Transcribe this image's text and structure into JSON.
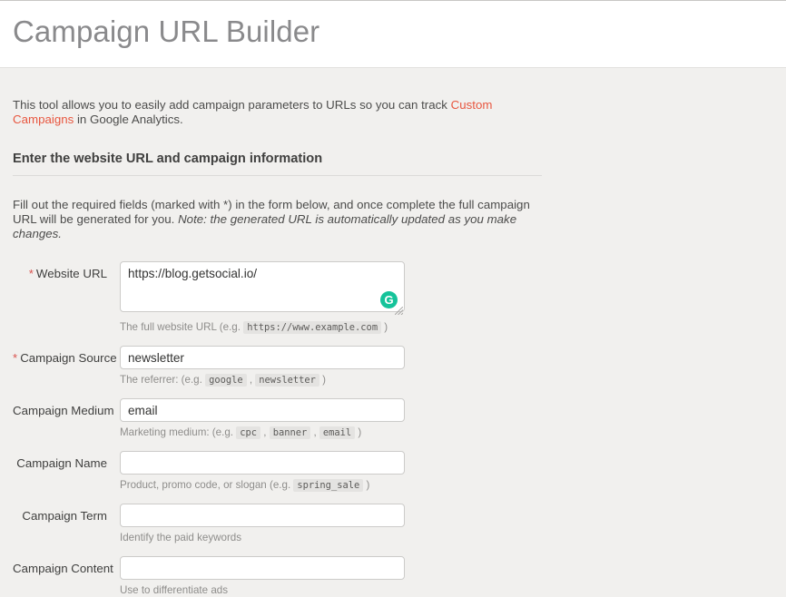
{
  "header": {
    "title": "Campaign URL Builder"
  },
  "intro": {
    "before_link": "This tool allows you to easily add campaign parameters to URLs so you can track ",
    "link_text": "Custom Campaigns",
    "after_link": " in Google Analytics."
  },
  "section": {
    "heading": "Enter the website URL and campaign information",
    "instructions_plain": "Fill out the required fields (marked with *) in the form below, and once complete the full campaign URL will be generated for you. ",
    "instructions_italic": "Note: the generated URL is automatically updated as you make changes."
  },
  "colors": {
    "page_background": "#f1f0ee",
    "header_background": "#ffffff",
    "link": "#e8563f",
    "required_asterisk": "#d9534f",
    "grammarly_green": "#15c39a",
    "input_border": "#cccbc9",
    "title_text": "#8a8a8c"
  },
  "form": {
    "fields": [
      {
        "label": "Website URL",
        "required": true,
        "required_marker": "*",
        "type": "textarea",
        "value": "https://blog.getsocial.io/",
        "placeholder": "",
        "hint_prefix": "The full website URL (e.g. ",
        "hint_codes": [
          "https://www.example.com"
        ],
        "hint_suffix": ")",
        "badge": "G",
        "badge_name": "grammarly-icon"
      },
      {
        "label": "Campaign Source",
        "required": true,
        "required_marker": "*",
        "type": "text",
        "value": "newsletter",
        "placeholder": "",
        "hint_prefix": "The referrer: (e.g. ",
        "hint_codes": [
          "google",
          "newsletter"
        ],
        "hint_suffix": ")"
      },
      {
        "label": "Campaign Medium",
        "required": false,
        "required_marker": "",
        "type": "text",
        "value": "email",
        "placeholder": "",
        "hint_prefix": "Marketing medium: (e.g. ",
        "hint_codes": [
          "cpc",
          "banner",
          "email"
        ],
        "hint_suffix": ")"
      },
      {
        "label": "Campaign Name",
        "required": false,
        "required_marker": "",
        "type": "text",
        "value": "",
        "placeholder": "",
        "hint_prefix": "Product, promo code, or slogan (e.g. ",
        "hint_codes": [
          "spring_sale"
        ],
        "hint_suffix": ")"
      },
      {
        "label": "Campaign Term",
        "required": false,
        "required_marker": "",
        "type": "text",
        "value": "",
        "placeholder": "",
        "hint_prefix": "Identify the paid keywords",
        "hint_codes": [],
        "hint_suffix": ""
      },
      {
        "label": "Campaign Content",
        "required": false,
        "required_marker": "",
        "type": "text",
        "value": "",
        "placeholder": "",
        "hint_prefix": "Use to differentiate ads",
        "hint_codes": [],
        "hint_suffix": ""
      }
    ]
  }
}
